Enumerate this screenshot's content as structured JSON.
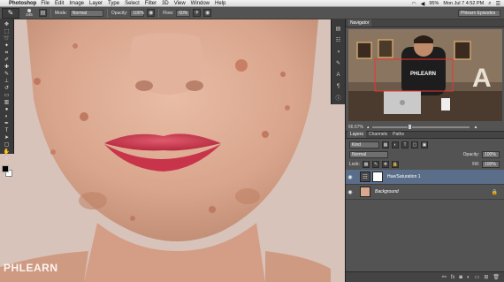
{
  "menubar": {
    "app_name": "Photoshop",
    "items": [
      "File",
      "Edit",
      "Image",
      "Layer",
      "Type",
      "Select",
      "Filter",
      "3D",
      "View",
      "Window",
      "Help"
    ],
    "battery": "95%",
    "clock": "Mon Jul 7  4:52 PM"
  },
  "options": {
    "brush_size": "245",
    "mode_label": "Mode:",
    "mode_value": "Normal",
    "opacity_label": "Opacity:",
    "opacity_value": "100%",
    "flow_label": "Flow:",
    "flow_value": "60%",
    "workspace": "Phlearn Episodes"
  },
  "navigator": {
    "tabs": [
      "Navigator"
    ],
    "zoom": "66.67%",
    "thumb_text": "PHLEARN"
  },
  "layers": {
    "tabs": [
      "Layers",
      "Channels",
      "Paths"
    ],
    "filter_kind": "Kind",
    "blend_mode": "Normal",
    "opacity_label": "Opacity:",
    "opacity_value": "100%",
    "lock_label": "Lock:",
    "fill_label": "Fill:",
    "fill_value": "100%",
    "items": [
      {
        "name": "Hue/Saturation 1",
        "selected": true
      },
      {
        "name": "Background",
        "selected": false
      }
    ]
  },
  "watermark": "PHLEARN",
  "colors": {
    "ui_dark": "#3a3a3a",
    "panel": "#535353",
    "selected_layer": "#5a6e8a",
    "skin": "#d8a58e",
    "lips": "#c8344a"
  }
}
